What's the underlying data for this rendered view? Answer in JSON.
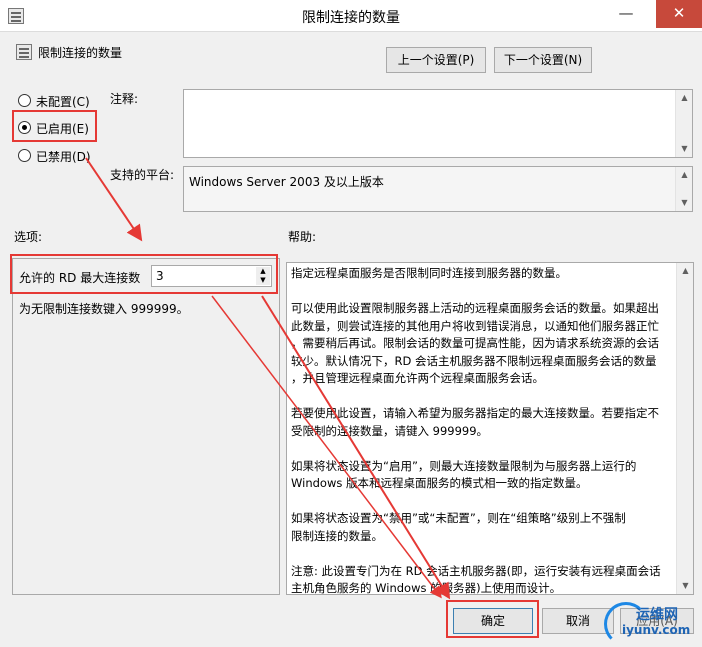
{
  "window": {
    "title": "限制连接的数量",
    "buttons": {
      "minimize": "—",
      "maximize": "☐",
      "close": "✕"
    }
  },
  "header": {
    "policy_name": "限制连接的数量",
    "prev_button": "上一个设置(P)",
    "next_button": "下一个设置(N)"
  },
  "state": {
    "options": [
      {
        "label": "未配置(C)",
        "checked": false
      },
      {
        "label": "已启用(E)",
        "checked": true
      },
      {
        "label": "已禁用(D)",
        "checked": false
      }
    ]
  },
  "comment": {
    "label": "注释:",
    "value": ""
  },
  "supported": {
    "label": "支持的平台:",
    "value": "Windows Server 2003 及以上版本"
  },
  "options_panel": {
    "label": "选项:",
    "field_label": "允许的 RD 最大连接数",
    "field_value": "3",
    "hint": "为无限制连接数键入 999999。"
  },
  "help_panel": {
    "label": "帮助:",
    "lines": [
      "指定远程桌面服务是否限制同时连接到服务器的数量。",
      "",
      "可以使用此设置限制服务器上活动的远程桌面服务会话的数量。如果超出",
      "此数量，则尝试连接的其他用户将收到错误消息，以通知他们服务器正忙",
      "，需要稍后再试。限制会话的数量可提高性能，因为请求系统资源的会话",
      "较少。默认情况下，RD 会话主机服务器不限制远程桌面服务会话的数量",
      "，并且管理远程桌面允许两个远程桌面服务会话。",
      "",
      "若要使用此设置，请输入希望为服务器指定的最大连接数量。若要指定不",
      "受限制的连接数量，请键入 999999。",
      "",
      "如果将状态设置为“启用”，则最大连接数量限制为与服务器上运行的",
      "Windows 版本和远程桌面服务的模式相一致的指定数量。",
      "",
      "如果将状态设置为“禁用”或“未配置”，则在“组策略”级别上不强制",
      "限制连接的数量。",
      "",
      "注意: 此设置专门为在 RD 会话主机服务器(即，运行安装有远程桌面会话",
      "主机角色服务的 Windows 的服务器)上使用而设计。"
    ]
  },
  "footer": {
    "ok": "确定",
    "cancel": "取消",
    "apply": "应用(A)"
  },
  "watermark": {
    "brand": "运维网",
    "url": "iyunv.com"
  }
}
